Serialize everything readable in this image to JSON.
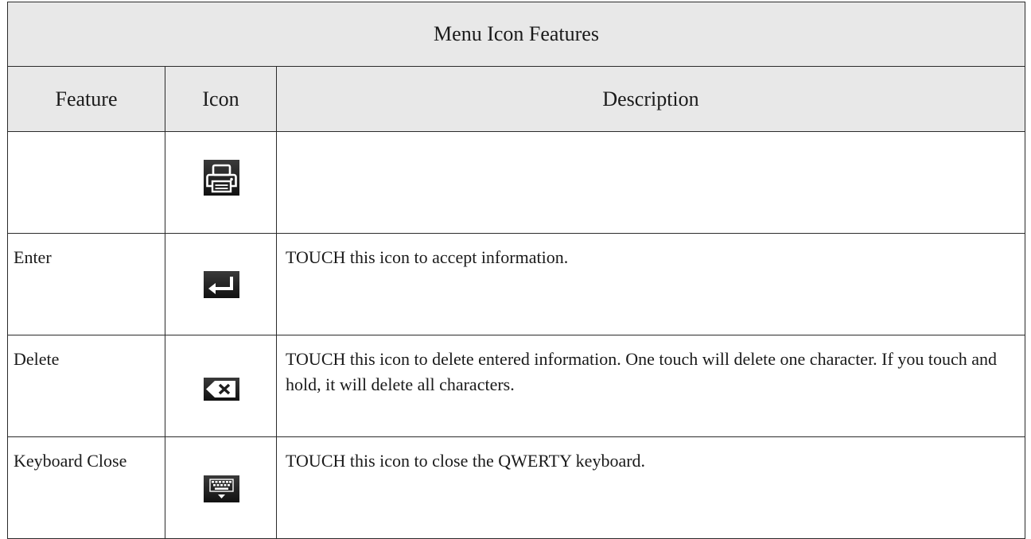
{
  "table": {
    "title": "Menu Icon Features",
    "headers": {
      "feature": "Feature",
      "icon": "Icon",
      "description": "Description"
    },
    "rows": [
      {
        "feature": "",
        "icon": "printer-icon",
        "description": ""
      },
      {
        "feature": "Enter",
        "icon": "enter-icon",
        "description": "TOUCH this icon to accept information."
      },
      {
        "feature": "Delete",
        "icon": "delete-icon",
        "description": "TOUCH this icon to delete entered information. One touch will delete one character. If you touch and hold, it will delete all characters."
      },
      {
        "feature": "Keyboard Close",
        "icon": "keyboard-close-icon",
        "description": "TOUCH this icon to close the QWERTY keyboard."
      }
    ]
  },
  "colors": {
    "header_background": "#e8e8e8",
    "border": "#2b2b2b",
    "icon_background": "#1e1e1e",
    "icon_foreground": "#ffffff"
  }
}
